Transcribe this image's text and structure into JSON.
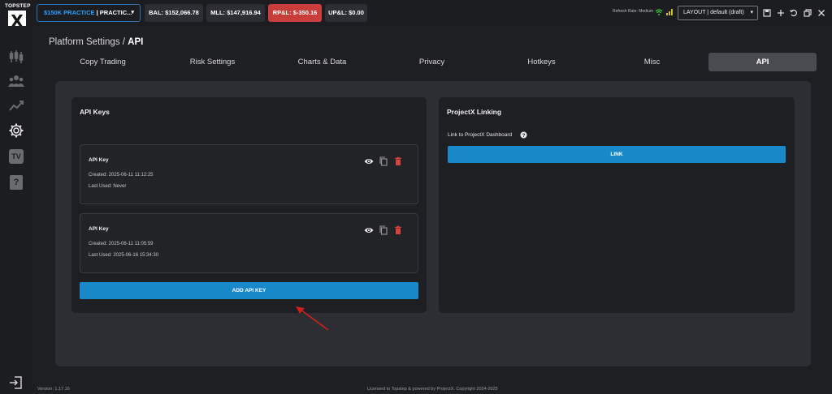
{
  "app": {
    "logo_text": "TOPSTEP",
    "logo_mark": "X"
  },
  "topbar": {
    "account_name": "$150K PRACTICE",
    "account_sep": "| PRACTIC...",
    "balance": "BAL: $152,066.78",
    "mll": "MLL: $147,916.94",
    "rpl": "RP&L: $-350.16",
    "upl": "UP&L: $0.00",
    "refresh_rate": "Refresh Rate: Medium",
    "layout_select": "LAYOUT | default (draft)",
    "colors": {
      "rpl_negative": "#c93d3b",
      "accent": "#1789c8",
      "account_border": "#2a6fb0"
    }
  },
  "breadcrumb": {
    "root": "Platform Settings / ",
    "current": "API"
  },
  "tabs": [
    {
      "label": "Copy Trading"
    },
    {
      "label": "Risk Settings"
    },
    {
      "label": "Charts & Data"
    },
    {
      "label": "Privacy"
    },
    {
      "label": "Hotkeys"
    },
    {
      "label": "Misc"
    },
    {
      "label": "API",
      "active": true
    }
  ],
  "api_keys": {
    "title": "API Keys",
    "items": [
      {
        "title": "API Key",
        "created": "Created: 2025-06-11 11:12:25",
        "last_used": "Last Used: Never"
      },
      {
        "title": "API Key",
        "created": "Created: 2025-06-11 11:05:59",
        "last_used": "Last Used: 2025-06-16 15:34:30"
      }
    ],
    "add_button": "ADD API KEY"
  },
  "projectx": {
    "title": "ProjectX Linking",
    "link_label": "Link to ProjectX Dashboard",
    "link_button": "LINK"
  },
  "footer": {
    "version": "Version: 1.17.16",
    "license": "Licensed to Topstep & powered by ProjectX. Copyright 2024-2025"
  },
  "sidebar_icons": [
    "candlestick-chart-icon",
    "users-icon",
    "analytics-icon",
    "gear-icon",
    "tv-icon",
    "help-icon",
    "logout-icon"
  ],
  "sidebar": {
    "tv_label": "TV",
    "help_label": "?"
  }
}
